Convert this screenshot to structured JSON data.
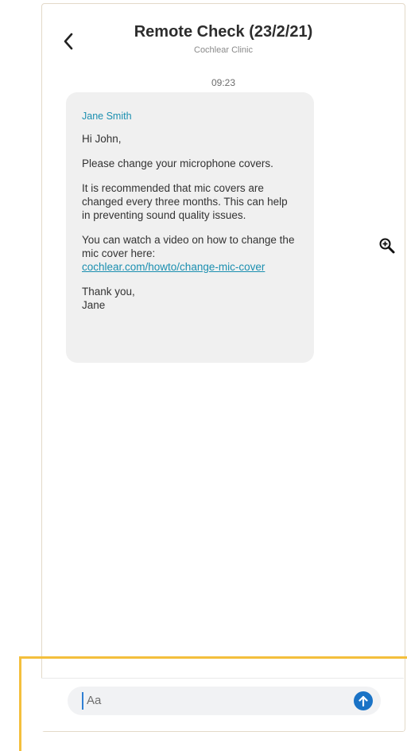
{
  "header": {
    "title": "Remote Check (23/2/21)",
    "subtitle": "Cochlear Clinic",
    "back_icon": "chevron-left-icon"
  },
  "conversation": {
    "timestamp": "09:23",
    "message": {
      "sender": "Jane Smith",
      "greeting": "Hi John,",
      "paragraph1": "Please change your microphone covers.",
      "paragraph2": "It is recommended that mic covers are changed every three months. This can help in preventing sound quality issues.",
      "paragraph3": "You can watch a video on how to change the mic cover here:",
      "link": "cochlear.com/howto/change-mic-cover",
      "signoff": "Thank you,",
      "signature": "Jane"
    }
  },
  "composer": {
    "placeholder": "Aa",
    "send_icon": "send-arrow-up-icon"
  },
  "overlay": {
    "zoom_icon": "zoom-in-icon",
    "highlight_color": "#f4bf3c"
  },
  "colors": {
    "accent": "#1b8fb0",
    "send_button": "#1a73c6",
    "bubble_bg": "#f0f0f0"
  }
}
